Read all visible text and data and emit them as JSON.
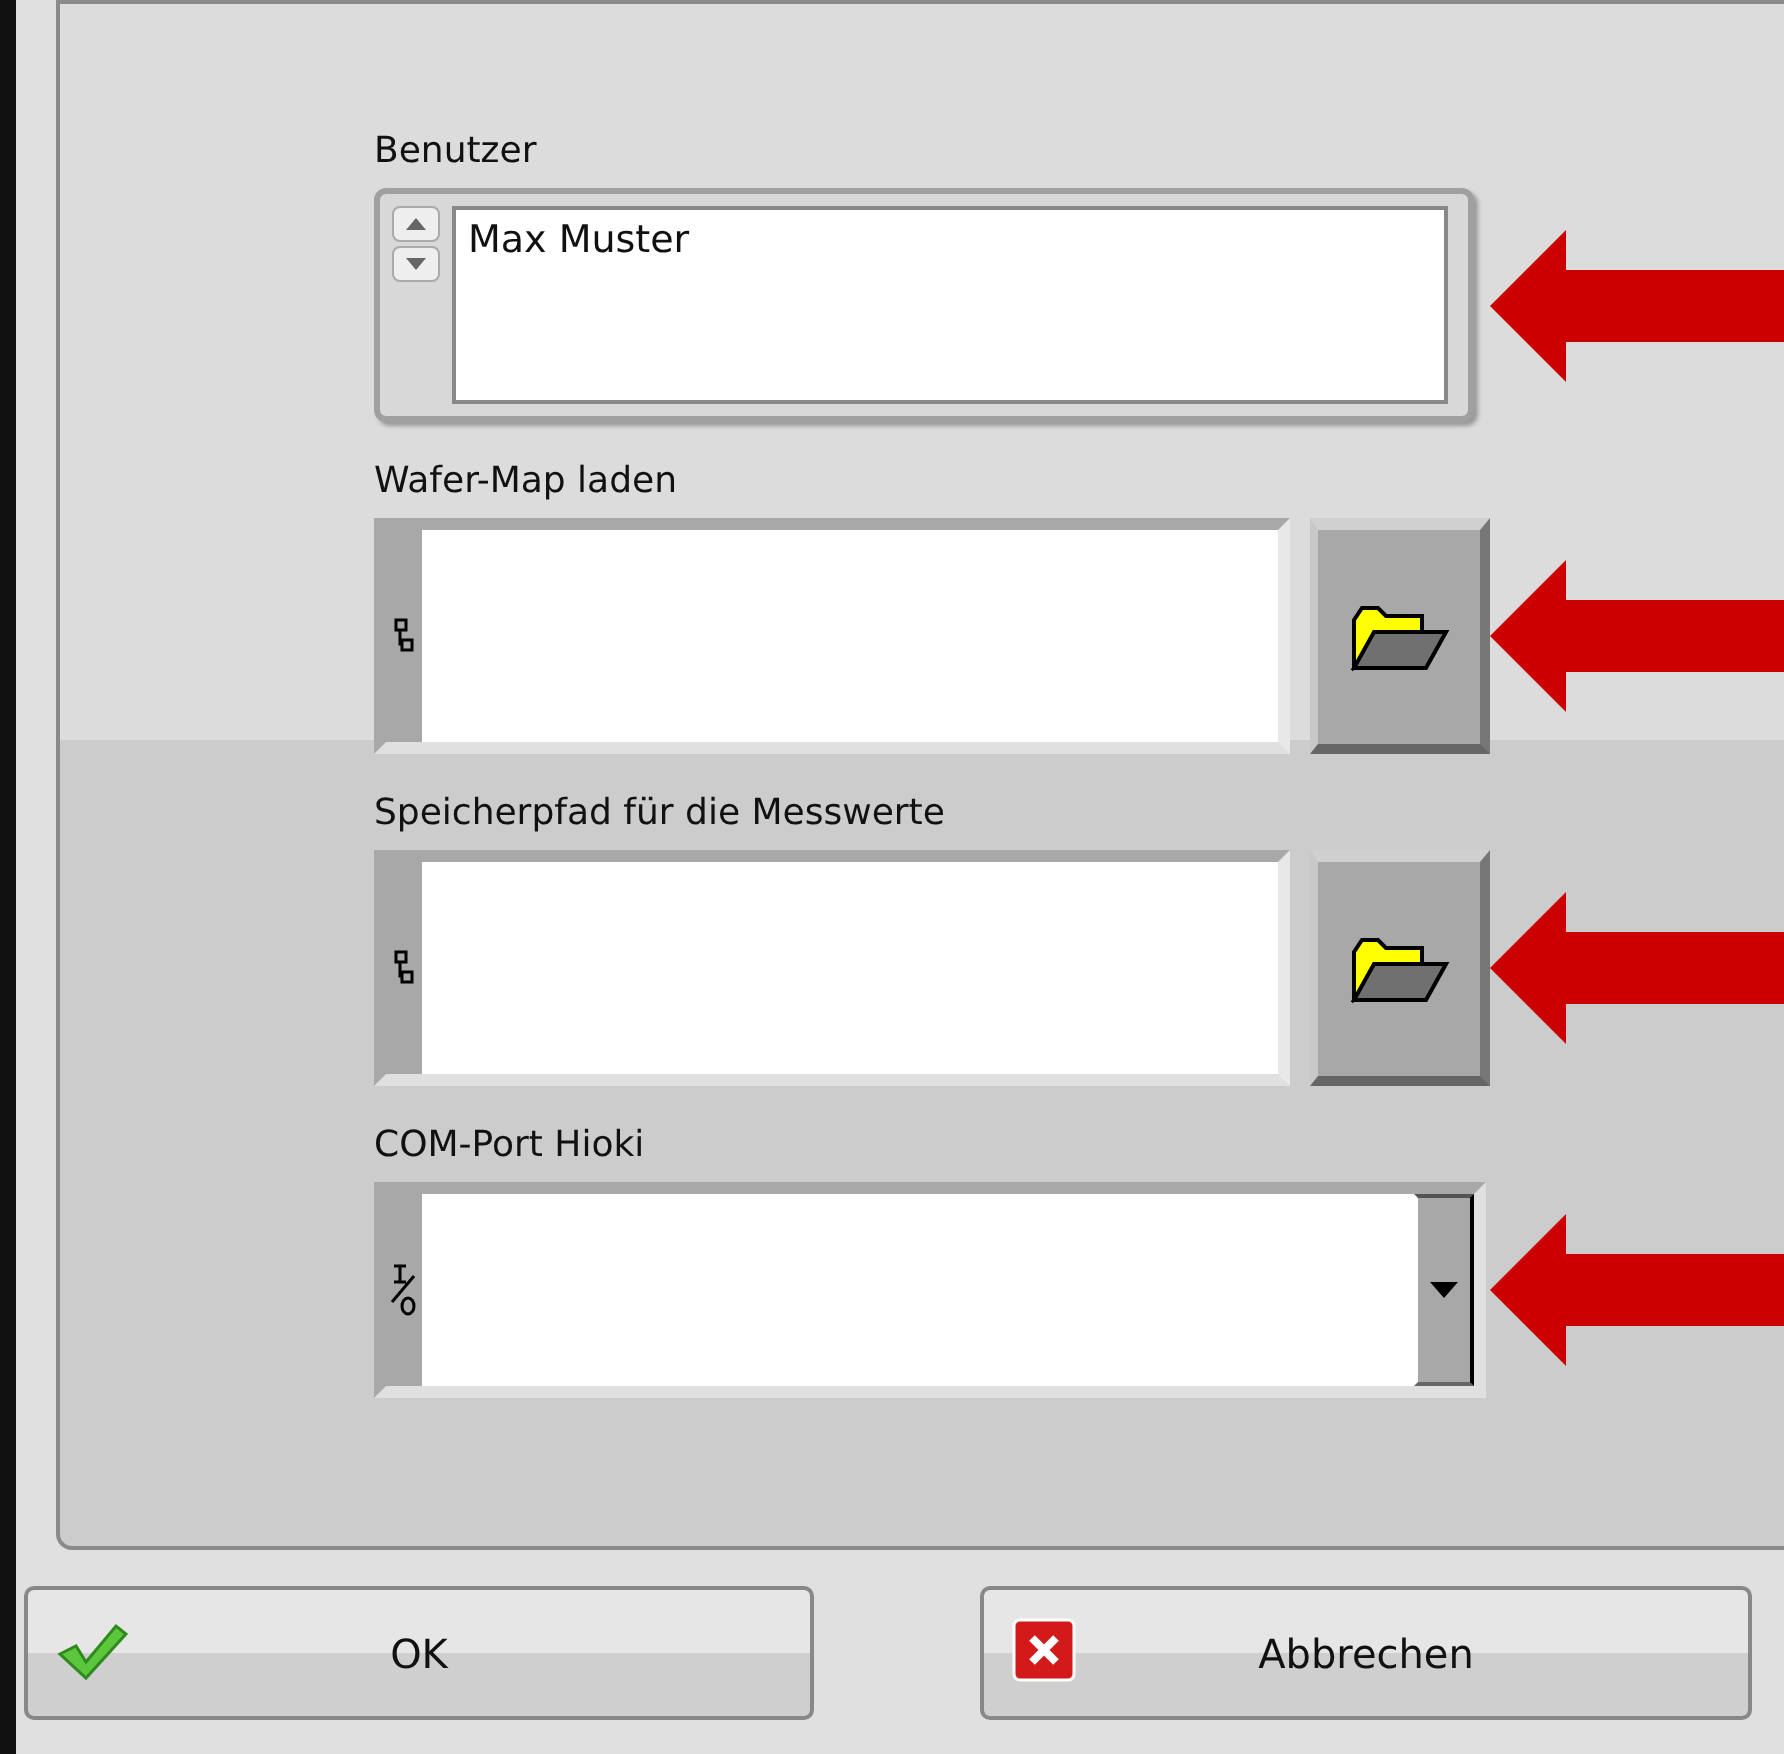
{
  "fields": [
    {
      "kind": "text",
      "label": "Benutzer",
      "value": "Max Muster"
    },
    {
      "kind": "path",
      "label": "Wafer-Map laden"
    },
    {
      "kind": "path",
      "label": "Speicherpfad für die Messwerte"
    },
    {
      "kind": "ring",
      "label": "COM-Port Hioki"
    }
  ],
  "buttons": [
    {
      "kind": "ok",
      "label": "OK"
    },
    {
      "kind": "cancel",
      "label": "Abbrechen"
    }
  ]
}
